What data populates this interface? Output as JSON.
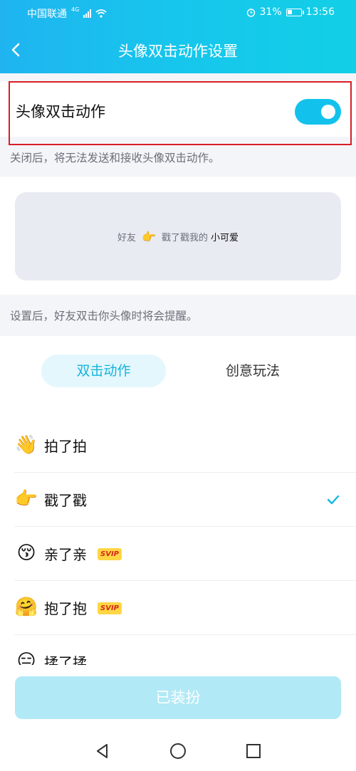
{
  "status_bar": {
    "carrier": "中国联通",
    "network": "4G",
    "battery": "31%",
    "time": "13:56"
  },
  "header": {
    "title": "头像双击动作设置"
  },
  "toggle": {
    "label": "头像双击动作",
    "enabled": true
  },
  "toggle_note": "关闭后，将无法发送和接收头像双击动作。",
  "preview": {
    "prefix": "好友",
    "hand_emoji": "👉",
    "action": "戳了戳我的",
    "suffix": "小可爱"
  },
  "preview_note": "设置后，好友双击你头像时将会提醒。",
  "tabs": [
    {
      "label": "双击动作",
      "active": true
    },
    {
      "label": "创意玩法",
      "active": false
    }
  ],
  "actions": [
    {
      "emoji": "👋",
      "label": "拍了拍",
      "svip": false,
      "selected": false
    },
    {
      "emoji": "👉",
      "label": "戳了戳",
      "svip": false,
      "selected": true
    },
    {
      "emoji": "😚",
      "label": "亲了亲",
      "svip": true,
      "selected": false
    },
    {
      "emoji": "🤗",
      "label": "抱了抱",
      "svip": true,
      "selected": false
    },
    {
      "emoji": "😑",
      "label": "揉了揉",
      "svip": false,
      "selected": false
    }
  ],
  "svip_badge": "SVIP",
  "apply_button": "已装扮",
  "colors": {
    "accent": "#12c2ec",
    "highlight_border": "#d81f26"
  }
}
